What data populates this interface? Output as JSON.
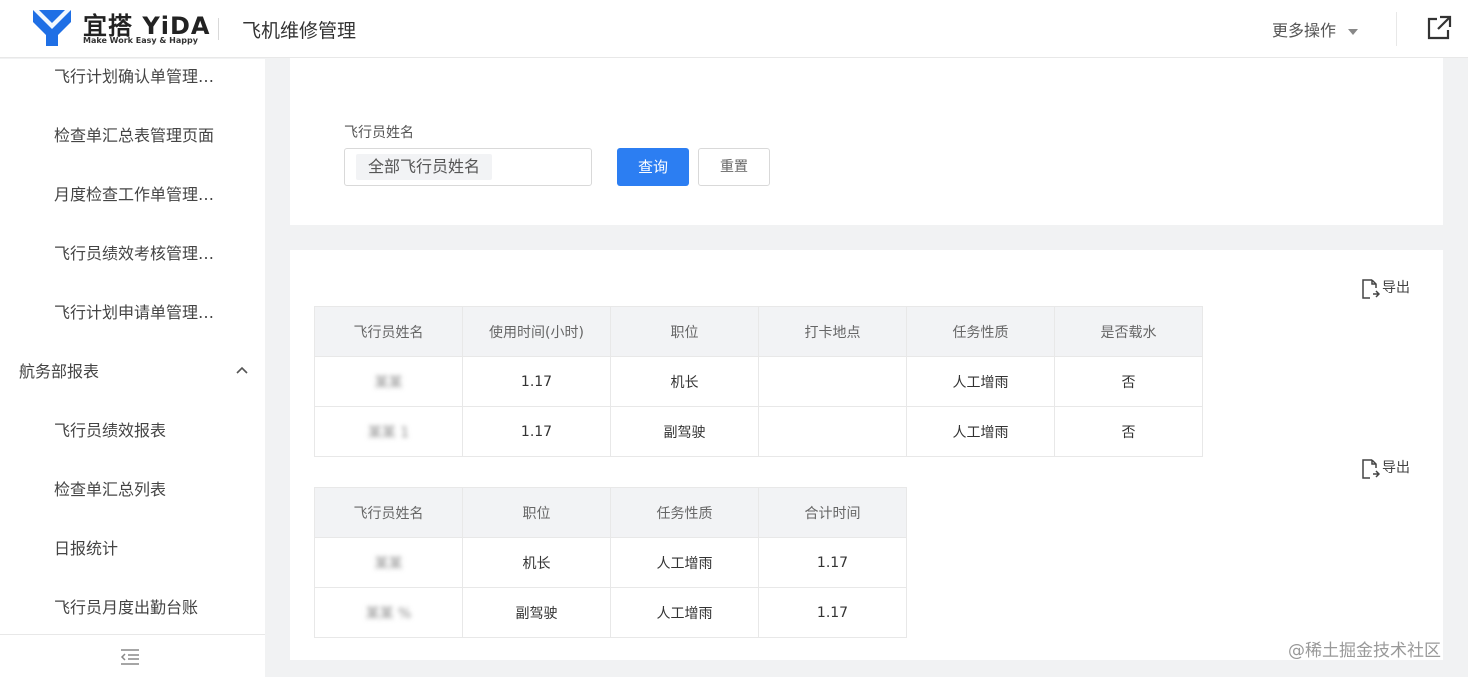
{
  "header": {
    "brand_name": "宜搭 YiDA",
    "brand_slogan": "Make Work Easy & Happy",
    "app_title": "飞机维修管理",
    "more_actions": "更多操作"
  },
  "sidebar": {
    "items": [
      {
        "label": "飞行计划确认单管理…"
      },
      {
        "label": "检查单汇总表管理页面"
      },
      {
        "label": "月度检查工作单管理…"
      },
      {
        "label": "飞行员绩效考核管理…"
      },
      {
        "label": "飞行计划申请单管理…"
      }
    ],
    "group": {
      "label": "航务部报表",
      "expanded": true
    },
    "group_items": [
      {
        "label": "飞行员绩效报表"
      },
      {
        "label": "检查单汇总列表"
      },
      {
        "label": "日报统计"
      },
      {
        "label": "飞行员月度出勤台账"
      }
    ]
  },
  "filter": {
    "field_label": "飞行员姓名",
    "select_value": "全部飞行员姓名",
    "query_label": "查询",
    "reset_label": "重置"
  },
  "table1": {
    "export_label": "导出",
    "columns": [
      "飞行员姓名",
      "使用时间(小时)",
      "职位",
      "打卡地点",
      "任务性质",
      "是否载水"
    ],
    "rows": [
      [
        "某某",
        "1.17",
        "机长",
        "",
        "人工增雨",
        "否"
      ],
      [
        "某某 1",
        "1.17",
        "副驾驶",
        "",
        "人工增雨",
        "否"
      ]
    ]
  },
  "table2": {
    "export_label": "导出",
    "columns": [
      "飞行员姓名",
      "职位",
      "任务性质",
      "合计时间"
    ],
    "rows": [
      [
        "某某",
        "机长",
        "人工增雨",
        "1.17"
      ],
      [
        "某某 %",
        "副驾驶",
        "人工增雨",
        "1.17"
      ]
    ]
  },
  "watermark": "@稀土掘金技术社区",
  "colors": {
    "primary": "#2c7ef2",
    "page_bg": "#f1f2f3",
    "header_bg": "#f2f3f5"
  }
}
